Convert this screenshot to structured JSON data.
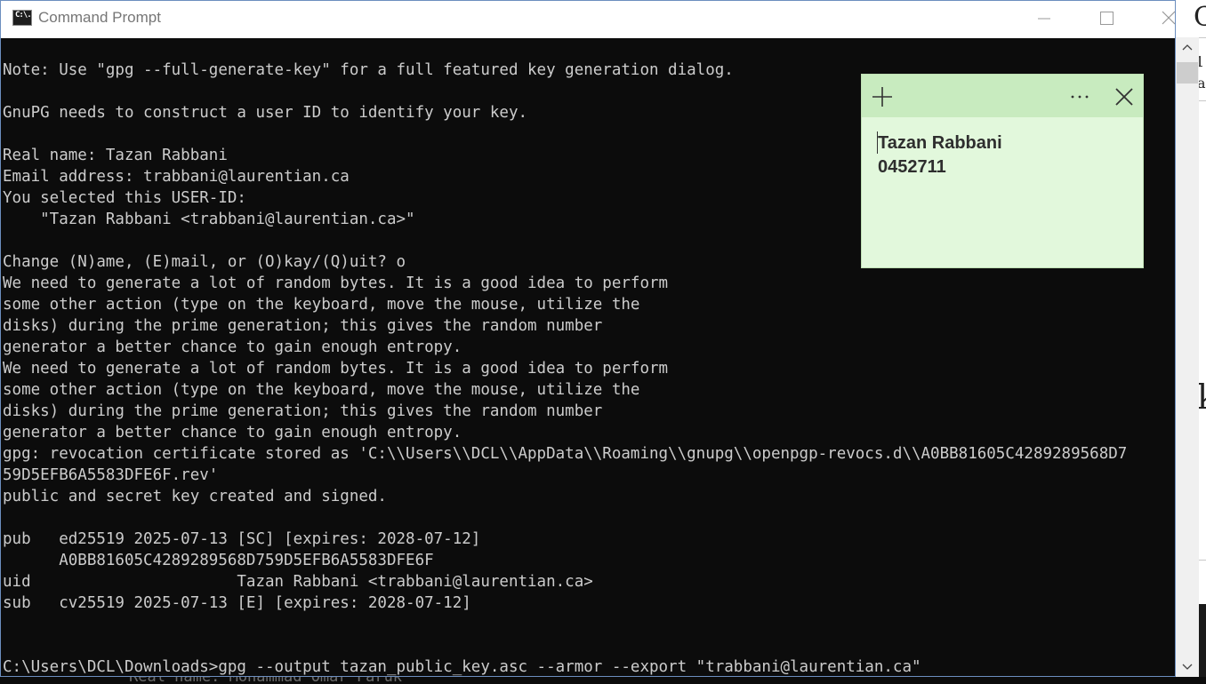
{
  "window": {
    "title": "Command Prompt",
    "icon_text": "C:\\."
  },
  "console": {
    "lines": [
      "Note: Use \"gpg --full-generate-key\" for a full featured key generation dialog.",
      "",
      "GnuPG needs to construct a user ID to identify your key.",
      "",
      "Real name: Tazan Rabbani",
      "Email address: trabbani@laurentian.ca",
      "You selected this USER-ID:",
      "    \"Tazan Rabbani <trabbani@laurentian.ca>\"",
      "",
      "Change (N)ame, (E)mail, or (O)kay/(Q)uit? o",
      "We need to generate a lot of random bytes. It is a good idea to perform",
      "some other action (type on the keyboard, move the mouse, utilize the",
      "disks) during the prime generation; this gives the random number",
      "generator a better chance to gain enough entropy.",
      "We need to generate a lot of random bytes. It is a good idea to perform",
      "some other action (type on the keyboard, move the mouse, utilize the",
      "disks) during the prime generation; this gives the random number",
      "generator a better chance to gain enough entropy.",
      "gpg: revocation certificate stored as 'C:\\\\Users\\\\DCL\\\\AppData\\\\Roaming\\\\gnupg\\\\openpgp-revocs.d\\\\A0BB81605C4289289568D7",
      "59D5EFB6A5583DFE6F.rev'",
      "public and secret key created and signed.",
      "",
      "pub   ed25519 2025-07-13 [SC] [expires: 2028-07-12]",
      "      A0BB81605C4289289568D759D5EFB6A5583DFE6F",
      "uid                      Tazan Rabbani <trabbani@laurentian.ca>",
      "sub   cv25519 2025-07-13 [E] [expires: 2028-07-12]",
      "",
      "",
      "C:\\Users\\DCL\\Downloads>gpg --output tazan_public_key.asc --armor --export \"trabbani@laurentian.ca\""
    ]
  },
  "sticky_note": {
    "line1": "Tazan Rabbani",
    "line2": "0452711"
  },
  "background": {
    "console_peek": "Real name: Mohammad Omar Faruk",
    "glyph_k": "k"
  },
  "colors": {
    "console_bg": "#0c0c0c",
    "console_text": "#cccccc",
    "sticky_body": "#e2f8dc",
    "sticky_header": "#c8ebbf"
  }
}
